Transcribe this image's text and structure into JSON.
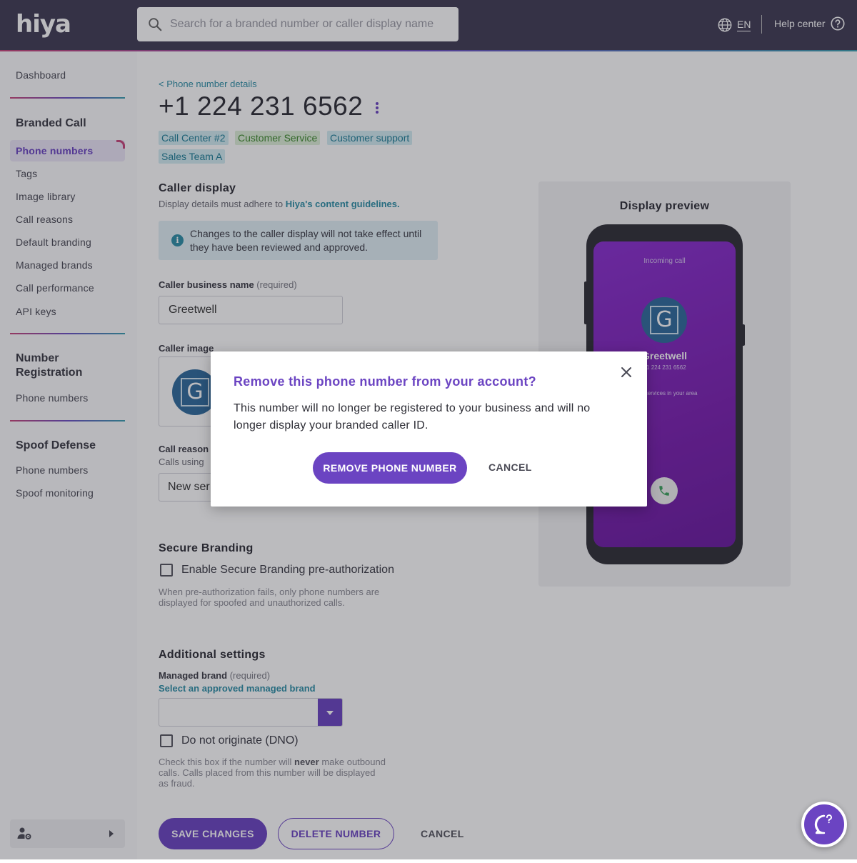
{
  "topbar": {
    "logo": "hiya",
    "search_placeholder": "Search for a branded number or caller display name",
    "language": "EN",
    "help": "Help center"
  },
  "sidebar": {
    "dashboard": "Dashboard",
    "branded_call": {
      "heading": "Branded Call",
      "items": [
        "Phone numbers",
        "Tags",
        "Image library",
        "Call reasons",
        "Default branding",
        "Managed brands",
        "Call performance",
        "API keys"
      ]
    },
    "number_registration": {
      "heading_line1": "Number",
      "heading_line2": "Registration",
      "items": [
        "Phone numbers"
      ]
    },
    "spoof_defense": {
      "heading": "Spoof Defense",
      "items": [
        "Phone numbers",
        "Spoof monitoring"
      ]
    }
  },
  "main": {
    "back_link": "< Phone number details",
    "phone_number": "+1 224 231 6562",
    "tags": [
      "Call Center #2",
      "Customer Service",
      "Customer support",
      "Sales Team A"
    ],
    "caller_display": {
      "title": "Caller display",
      "hint_prefix": "Display details must adhere to ",
      "hint_link": "Hiya's content guidelines.",
      "info": "Changes to the caller display will not take effect until they have been reviewed and approved."
    },
    "business_name": {
      "label": "Caller business name",
      "required": "(required)",
      "value": "Greetwell"
    },
    "caller_image": {
      "label": "Caller image",
      "letter": "G"
    },
    "call_reason": {
      "label": "Call reason",
      "hint": "Calls using",
      "value": "New ser"
    },
    "secure_branding": {
      "title": "Secure Branding",
      "checkbox_label": "Enable Secure Branding pre-authorization",
      "hint": "When pre-authorization fails, only phone numbers are displayed for spoofed and unauthorized calls."
    },
    "additional": {
      "title": "Additional settings",
      "managed_brand_label": "Managed brand",
      "required": "(required)",
      "managed_brand_link": "Select an approved managed brand",
      "dno_label": "Do not originate (DNO)",
      "dno_hint_1": "Check this box if the number will ",
      "dno_hint_bold": "never",
      "dno_hint_2": " make outbound calls. Calls placed from this number will be displayed as fraud."
    },
    "buttons": {
      "save": "SAVE CHANGES",
      "delete": "DELETE NUMBER",
      "cancel": "CANCEL"
    }
  },
  "preview": {
    "title": "Display preview",
    "incoming": "Incoming call",
    "name": "Greetwell",
    "number": "+1 224 231 6562",
    "reason": "New services in your area"
  },
  "modal": {
    "title": "Remove this phone number from your account?",
    "body": "This number will no longer be registered to your business and will no longer display your branded caller ID.",
    "confirm": "REMOVE PHONE NUMBER",
    "cancel": "CANCEL"
  },
  "colors": {
    "brand_purple": "#6b44c2",
    "topbar": "#3f3b54",
    "link_teal": "#2d8fa6"
  }
}
